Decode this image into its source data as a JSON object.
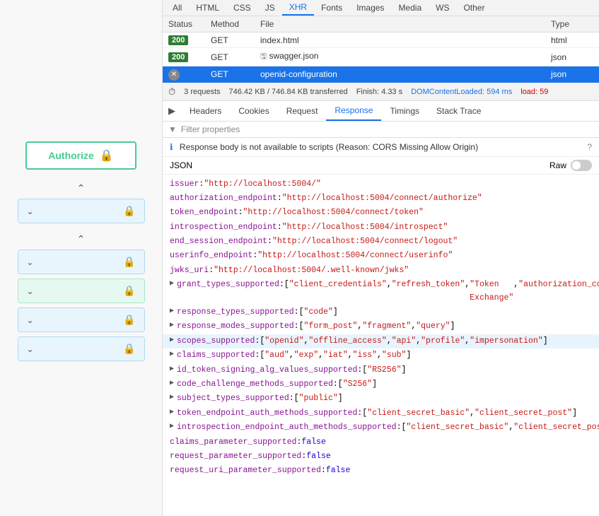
{
  "leftPanel": {
    "authorizeLabel": "Authorize",
    "lockIcon": "🔒"
  },
  "typeTabs": [
    "All",
    "HTML",
    "CSS",
    "JS",
    "XHR",
    "Fonts",
    "Images",
    "Media",
    "WS",
    "Other"
  ],
  "activeTypeTab": "XHR",
  "tableHeaders": {
    "status": "Status",
    "method": "Method",
    "file": "File",
    "type": "Type"
  },
  "networkRows": [
    {
      "status": "200",
      "method": "GET",
      "file": "index.html",
      "type": "html",
      "selected": false,
      "cancelled": false,
      "cached": false
    },
    {
      "status": "200",
      "method": "GET",
      "file": "swagger.json",
      "type": "json",
      "selected": false,
      "cancelled": false,
      "cached": true
    },
    {
      "status": "",
      "method": "GET",
      "file": "openid-configuration",
      "type": "json",
      "selected": true,
      "cancelled": true,
      "cached": false
    }
  ],
  "stats": {
    "requests": "3 requests",
    "transferred": "746.42 KB / 746.84 KB transferred",
    "finish": "Finish: 4.33 s",
    "domContentLoaded": "DOMContentLoaded: 594 ms",
    "load": "load: 59"
  },
  "detailTabs": [
    "Headers",
    "Cookies",
    "Request",
    "Response",
    "Timings",
    "Stack Trace"
  ],
  "activeDetailTab": "Response",
  "filterPlaceholder": "Filter properties",
  "corsWarning": "Response body is not available to scripts (Reason: CORS Missing Allow Origin)",
  "jsonLabel": "JSON",
  "rawLabel": "Raw",
  "jsonData": {
    "issuer": "http://localhost:5004/",
    "authorization_endpoint": "http://localhost:5004/connect/authorize",
    "token_endpoint": "http://localhost:5004/connect/token",
    "introspection_endpoint": "http://localhost:5004/introspect",
    "end_session_endpoint": "http://localhost:5004/connect/logout",
    "userinfo_endpoint": "http://localhost:5004/connect/userinfo",
    "jwks_uri": "http://localhost:5004/.well-known/jwks",
    "grant_types_supported": [
      "client_credentials",
      "refresh_token",
      "Token Exchange",
      "authorization_code"
    ],
    "response_types_supported": [
      "code"
    ],
    "response_modes_supported": [
      "form_post",
      "fragment",
      "query"
    ],
    "scopes_supported": [
      "openid",
      "offline_access",
      "api",
      "profile",
      "impersonation"
    ],
    "claims_supported": [
      "aud",
      "exp",
      "iat",
      "iss",
      "sub"
    ],
    "id_token_signing_alg_values_supported": [
      "RS256"
    ],
    "code_challenge_methods_supported": [
      "S256"
    ],
    "subject_types_supported": [
      "public"
    ],
    "token_endpoint_auth_methods_supported": [
      "client_secret_basic",
      "client_secret_post"
    ],
    "introspection_endpoint_auth_methods_supported": [
      "client_secret_basic",
      "client_secret_post"
    ],
    "claims_parameter_supported": "false",
    "request_parameter_supported": "false",
    "request_uri_parameter_supported": "false"
  }
}
